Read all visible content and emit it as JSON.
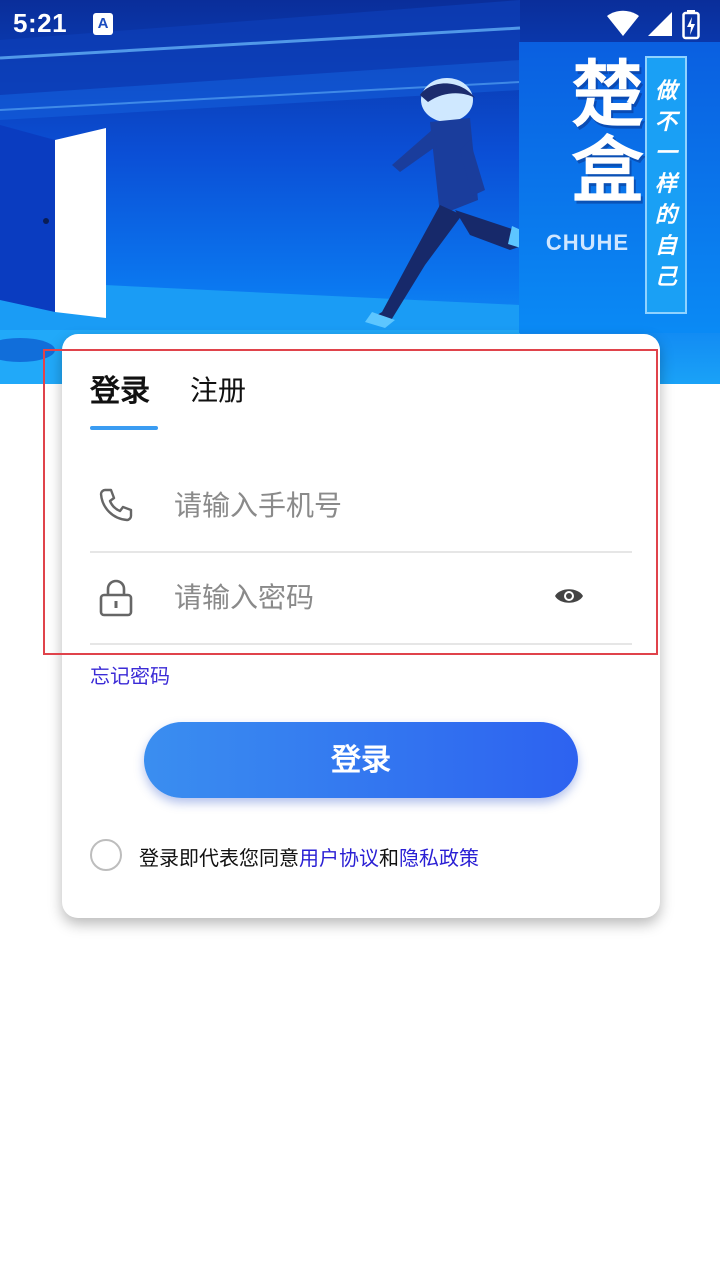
{
  "status_bar": {
    "time": "5:21",
    "app_icon_letter": "A",
    "icons": [
      "wifi-icon",
      "signal-icon",
      "battery-charging-icon"
    ]
  },
  "banner": {
    "brand_title": "楚盒",
    "brand_subtitle": "CHUHE",
    "slogan": "做不一样的自己",
    "colors": {
      "deep_blue": "#0a2e9a",
      "bright_blue": "#0b78f0",
      "cyan": "#1aa2f7"
    }
  },
  "tabs": {
    "login": "登录",
    "register": "注册",
    "active": "login"
  },
  "form": {
    "phone": {
      "placeholder": "请输入手机号",
      "value": ""
    },
    "password": {
      "placeholder": "请输入密码",
      "value": ""
    },
    "forgot_password": "忘记密码"
  },
  "login_button": "登录",
  "agreement": {
    "checked": false,
    "prefix": "登录即代表您同意",
    "user_agreement": "用户协议",
    "and": "和",
    "privacy_policy": "隐私政策"
  },
  "accent_colors": {
    "button_start": "#3a8ef0",
    "button_end": "#2d62f0",
    "link": "#2a1fd4",
    "highlight_frame": "#e0434b"
  }
}
